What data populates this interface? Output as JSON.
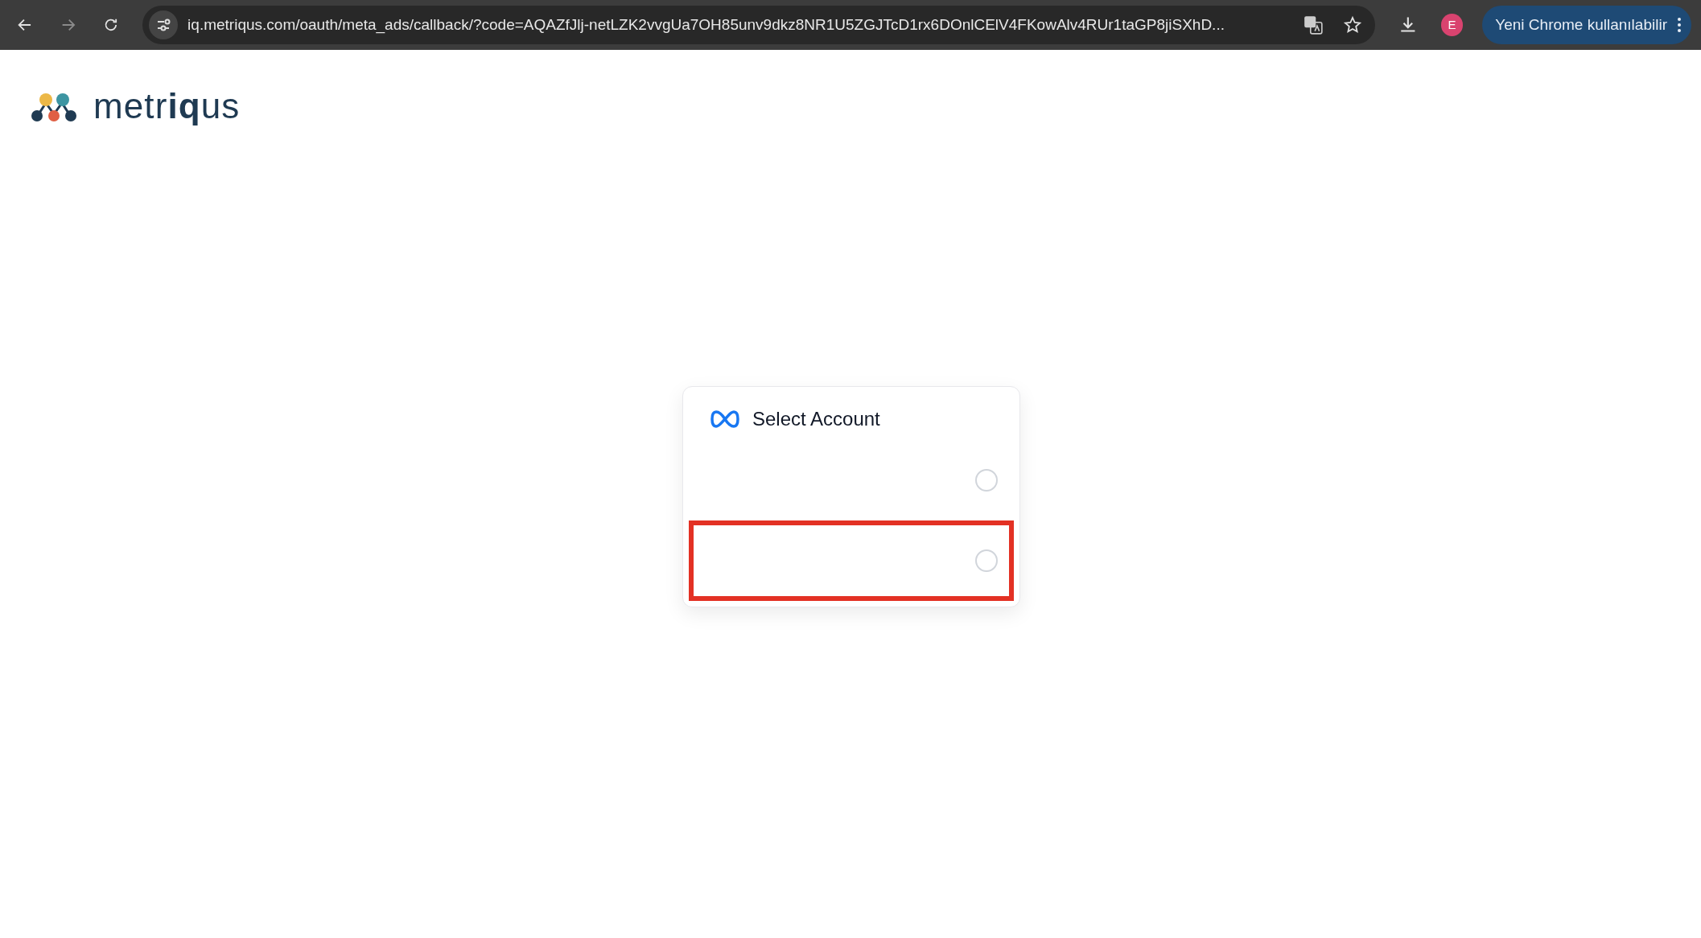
{
  "browser": {
    "url": "iq.metriqus.com/oauth/meta_ads/callback/?code=AQAZfJlj-netLZK2vvgUa7OH85unv9dkz8NR1U5ZGJTcD1rx6DOnlCElV4FKowAlv4RUr1taGP8jiSXhD...",
    "profile_initial": "E",
    "update_button": "Yeni Chrome kullanılabilir"
  },
  "logo": {
    "text": "metr**iq**us"
  },
  "dialog": {
    "title": "Select Account",
    "accounts": [
      {
        "selected": false,
        "highlighted": false
      },
      {
        "selected": false,
        "highlighted": true
      }
    ]
  }
}
